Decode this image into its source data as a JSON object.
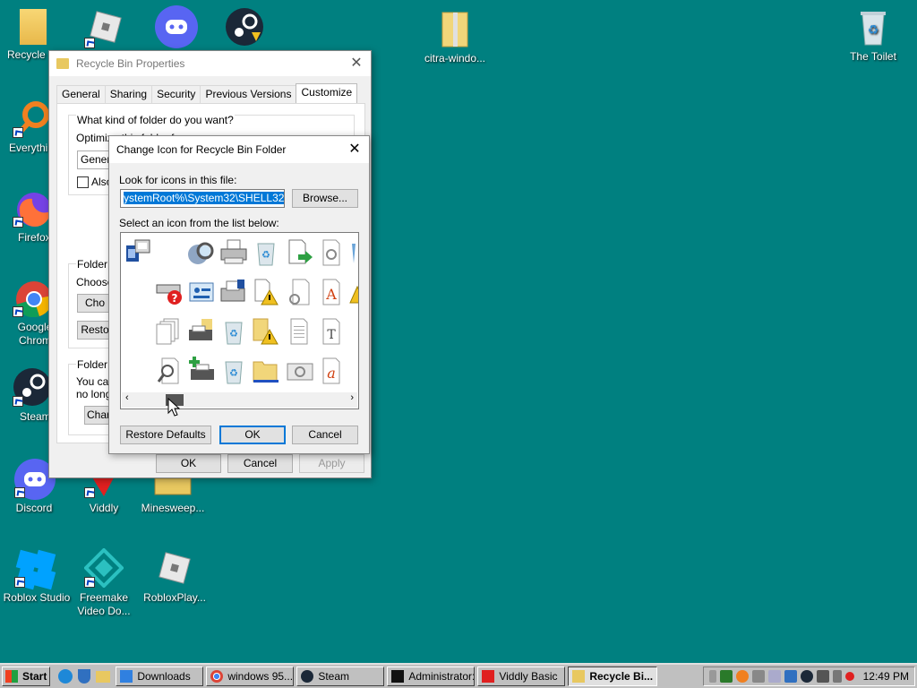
{
  "desktop": {
    "icons": {
      "recycle_left": "Recycle",
      "everything": "Everythi",
      "firefox": "Firefox",
      "chrome": "Google Chrom",
      "steam": "Steam",
      "discord": "Discord",
      "viddly": "Viddly",
      "minesweeper": "Minesweep...",
      "roblox_studio": "Roblox Studio",
      "freemake": "Freemake Video Do...",
      "roblox_player": "RobloxPlay...",
      "citra": "citra-windo...",
      "the_toilet": "The Toilet"
    }
  },
  "properties": {
    "title": "Recycle Bin Properties",
    "tabs": [
      "General",
      "Sharing",
      "Security",
      "Previous Versions",
      "Customize"
    ],
    "q_folder": "What kind of folder do you want?",
    "optimize": "Optimize this folder for:",
    "general_value": "Genera",
    "also_label": "Also",
    "folder_pictures": "Folder p",
    "choose": "Choose",
    "choose_btn": "Cho",
    "restore_btn": "Resto",
    "folder_icons": "Folder ic",
    "you_can": "You ca",
    "no_longer": "no longe",
    "change_btn": "Char",
    "ok": "OK",
    "cancel": "Cancel",
    "apply": "Apply"
  },
  "change_icon": {
    "title": "Change Icon for Recycle Bin Folder",
    "look_label": "Look for icons in this file:",
    "path_value": "ystemRoot%\\System32\\SHELL32.dll",
    "browse": "Browse...",
    "select_label": "Select an icon from the list below:",
    "restore_defaults": "Restore Defaults",
    "ok": "OK",
    "cancel": "Cancel"
  },
  "taskbar": {
    "start": "Start",
    "items": {
      "downloads": "Downloads",
      "windows95": "windows 95...",
      "steam": "Steam",
      "admin": "Administrator:...",
      "viddly": "Viddly Basic",
      "recycle": "Recycle Bi..."
    },
    "clock": "12:49 PM"
  },
  "colors": {
    "desktop": "#008080",
    "accent": "#0078d7"
  }
}
